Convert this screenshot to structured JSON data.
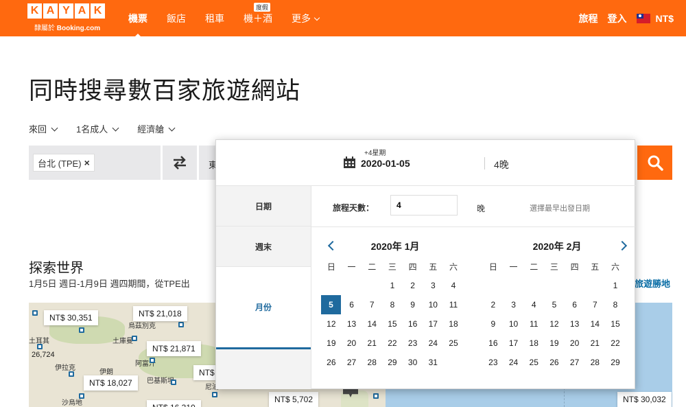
{
  "brand": {
    "logo_letters": [
      "K",
      "A",
      "Y",
      "A",
      "K"
    ],
    "tagline_prefix": "隸屬於",
    "tagline_brand": "Booking.com"
  },
  "nav": {
    "items": [
      {
        "label": "機票",
        "active": true
      },
      {
        "label": "飯店"
      },
      {
        "label": "租車"
      },
      {
        "label": "機＋酒",
        "badge": "度假"
      },
      {
        "label": "更多"
      }
    ],
    "trips_label": "旅程",
    "login_label": "登入",
    "currency": "NT$"
  },
  "page_title": "同時搜尋數百家旅遊網站",
  "options": {
    "trip_type": "來回",
    "passengers": "1名成人",
    "cabin": "經濟艙"
  },
  "search": {
    "origin_chip": "台北 (TPE)",
    "chip_remove": "×",
    "destination_text": "東"
  },
  "explore": {
    "title": "探索世界",
    "subtitle": "1月5日 週日-1月9日 週四期間，從TPE出",
    "link": "旅遊勝地"
  },
  "map": {
    "prices": [
      "NT$ 30,351",
      "NT$ 21,018",
      "NT$ 21,871",
      "26,724",
      "NT$ 18,027",
      "NT$",
      "NT$ 16,310",
      "NT$ 5,702",
      "NT$ 30,032"
    ],
    "places": [
      "阿富汗",
      "土庫曼",
      "烏茲別克",
      "土耳其",
      "伊拉克",
      "伊朗",
      "阿富汗",
      "巴基斯坦",
      "沙烏地",
      "尼泊"
    ]
  },
  "date_picker": {
    "weekday_note": "+4星期",
    "date_value": "2020-01-05",
    "nights_value": "4晚",
    "tabs": [
      "日期",
      "週末",
      "月份"
    ],
    "trip_length_label": "旅程天數：",
    "trip_length_value": "4",
    "trip_length_unit": "晚",
    "hint": "選擇最早出發日期",
    "weekdays": [
      "日",
      "一",
      "二",
      "三",
      "四",
      "五",
      "六"
    ],
    "months": [
      {
        "title": "2020年 1月",
        "offset": 3,
        "days": 31,
        "selected": 5
      },
      {
        "title": "2020年 2月",
        "offset": 6,
        "days": 29,
        "selected": null
      }
    ]
  },
  "colors": {
    "brand_orange": "#ff690f",
    "accent_blue": "#1f6a9e"
  }
}
